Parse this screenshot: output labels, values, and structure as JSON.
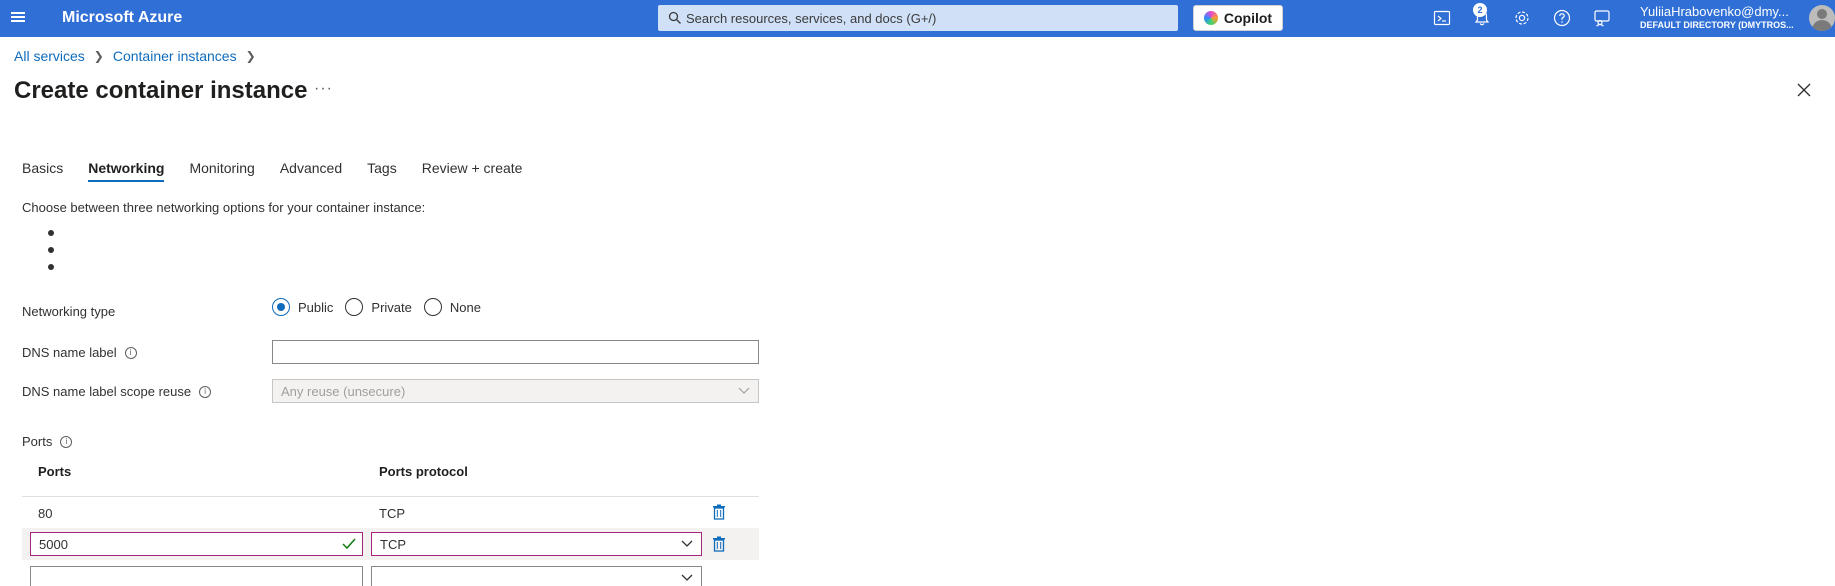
{
  "topbar": {
    "brand": "Microsoft Azure",
    "search_placeholder": "Search resources, services, and docs (G+/)",
    "copilot_label": "Copilot",
    "notification_count": "2",
    "user_name": "YuliiaHrabovenko@dmy...",
    "user_directory": "DEFAULT DIRECTORY (DMYTROS...",
    "icons": [
      "cloud-shell-icon",
      "notifications-icon",
      "settings-icon",
      "help-icon",
      "feedback-icon"
    ]
  },
  "breadcrumb": {
    "items": [
      "All services",
      "Container instances"
    ]
  },
  "page": {
    "title": "Create container instance",
    "more_label": "···"
  },
  "tabs": [
    {
      "label": "Basics",
      "active": false
    },
    {
      "label": "Networking",
      "active": true
    },
    {
      "label": "Monitoring",
      "active": false
    },
    {
      "label": "Advanced",
      "active": false
    },
    {
      "label": "Tags",
      "active": false
    },
    {
      "label": "Review + create",
      "active": false
    }
  ],
  "networking": {
    "intro": "Choose between three networking options for your container instance:",
    "networking_type_label": "Networking type",
    "options": [
      "Public",
      "Private",
      "None"
    ],
    "selected": "Public",
    "dns_label": "DNS name label",
    "dns_value": "",
    "dns_scope_label": "DNS name label scope reuse",
    "dns_scope_value": "Any reuse (unsecure)",
    "ports_label": "Ports"
  },
  "ports_table": {
    "headers": [
      "Ports",
      "Ports protocol"
    ],
    "rows": [
      {
        "port": "80",
        "protocol": "TCP"
      },
      {
        "port": "5000",
        "protocol": "TCP"
      },
      {
        "port": "",
        "protocol": ""
      }
    ]
  },
  "colors": {
    "topbar": "#2f6fd6",
    "accent": "#0f6cbd",
    "validation_border": "#a4267f",
    "valid_check": "#107c10"
  }
}
